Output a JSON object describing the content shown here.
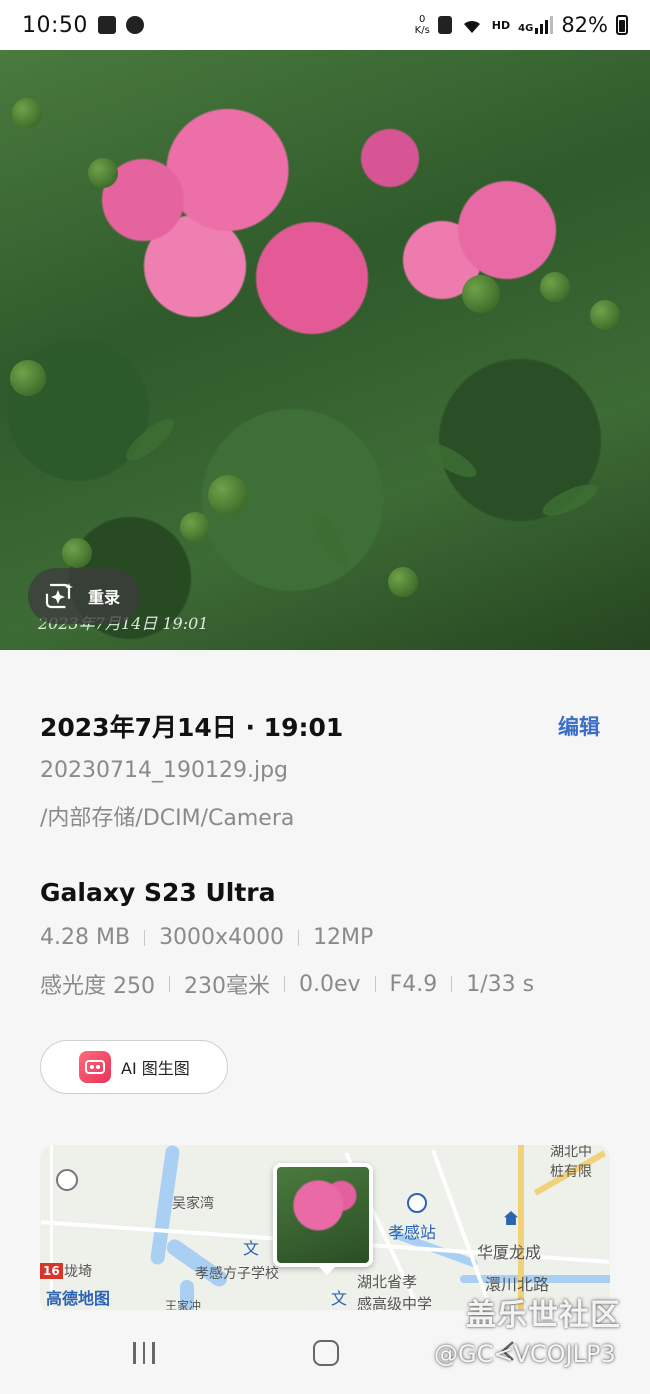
{
  "status_bar": {
    "time": "10:50",
    "net_speed_value": "0",
    "net_speed_unit": "K/s",
    "hd": "HD",
    "network": "4G",
    "battery_percent": "82%",
    "battery_level": 0.82
  },
  "photo": {
    "remaster_label": "重录",
    "stamp_text": "2023年7月14日 19:01"
  },
  "details": {
    "date_time": "2023年7月14日 · 19:01",
    "edit_label": "编辑",
    "file_name": "20230714_190129.jpg",
    "file_path": "/内部存储/DCIM/Camera",
    "device": "Galaxy S23 Ultra",
    "file_size": "4.28 MB",
    "resolution": "3000x4000",
    "megapixels": "12MP",
    "iso": "感光度 250",
    "focal_length": "230毫米",
    "exposure": "0.0ev",
    "aperture": "F4.9",
    "shutter": "1/33 s",
    "ai_button_label": "AI 图生图"
  },
  "map": {
    "logo": "高德地图",
    "labels": {
      "village": "吴家湾",
      "school1": "孝感方子学校",
      "station": "孝感站",
      "company1": "华厦龙成",
      "road": "澴川北路",
      "school2_line1": "湖北省孝",
      "school2_line2": "感高级中学",
      "top_right_line1": "湖北中",
      "top_right_line2": "桩有限",
      "bottom_left": "王家冲",
      "left_mid": "垅埼",
      "road_badge": "16",
      "wen1": "文",
      "wen2": "文"
    }
  },
  "watermark": {
    "brand": "盖乐世社区",
    "user": "@GC<VCOJLP3"
  }
}
